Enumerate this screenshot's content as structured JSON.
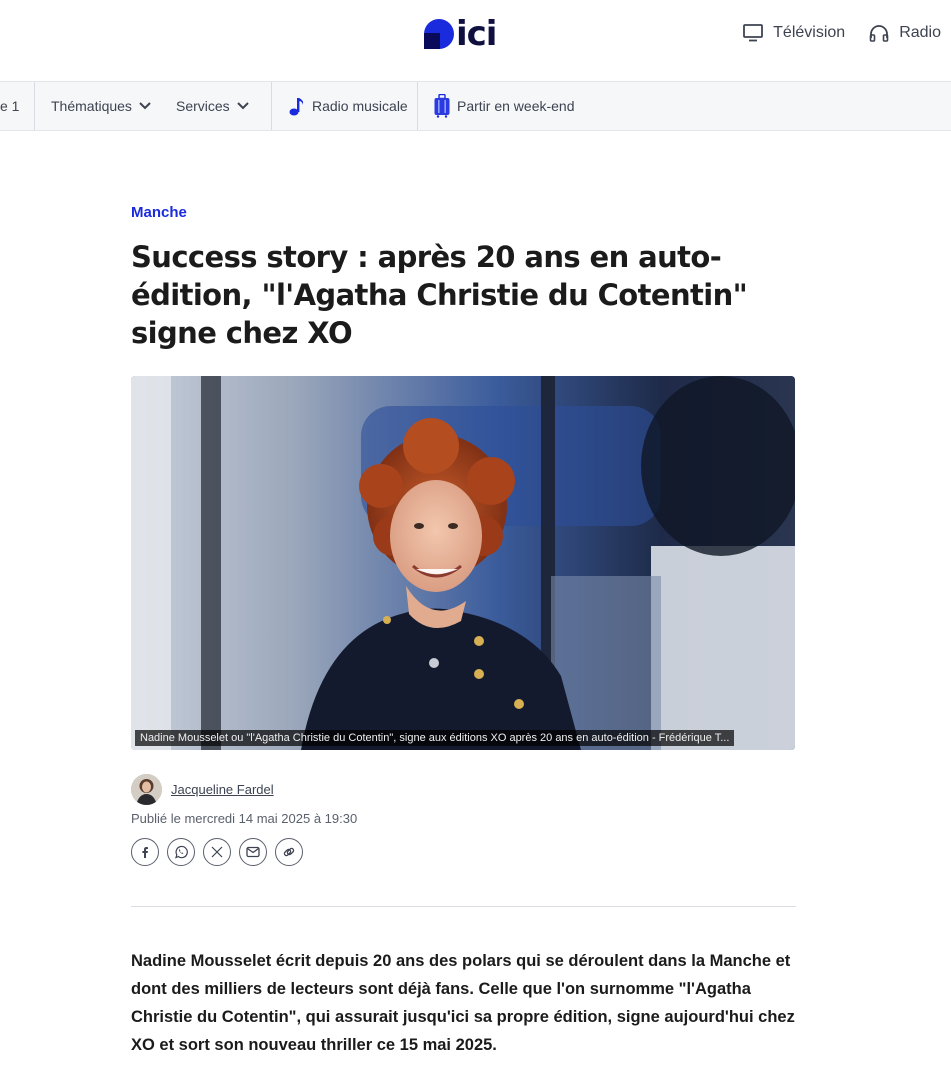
{
  "header": {
    "logo_text": "ici",
    "links": [
      {
        "label": "Télévision",
        "icon": "tv-icon"
      },
      {
        "label": "Radio",
        "icon": "headphones-icon"
      }
    ]
  },
  "nav": {
    "items": [
      {
        "label": "e 1"
      },
      {
        "label": "Thématiques",
        "icon": "chevron-down-icon"
      },
      {
        "label": "Services",
        "icon": "chevron-down-icon"
      },
      {
        "label": "Radio musicale",
        "icon": "music-note-icon"
      },
      {
        "label": "Partir en week-end",
        "icon": "suitcase-icon"
      }
    ]
  },
  "article": {
    "kicker": "Manche",
    "title": "Success story : après 20 ans en auto-édition, \"l'Agatha Christie du Cotentin\" signe chez XO",
    "image_caption": "Nadine Mousselet ou \"l'Agatha Christie du Cotentin\", signe aux éditions XO après 20 ans en auto-édition - Frédérique T...",
    "author": "Jacqueline Fardel",
    "published": "Publié le mercredi 14 mai 2025 à 19:30",
    "share_icons": [
      "facebook-icon",
      "whatsapp-icon",
      "x-icon",
      "email-icon",
      "link-icon"
    ],
    "lead": "Nadine Mousselet écrit depuis 20 ans des polars qui se déroulent dans la Manche et dont des milliers de lecteurs sont déjà fans. Celle que l'on surnomme \"l'Agatha Christie du Cotentin\", qui assurait jusqu'ici sa propre édition, signe aujourd'hui chez XO et sort son nouveau thriller ce 15 mai 2025."
  },
  "colors": {
    "brand_blue": "#1a2bdd",
    "text": "#1b1b1b",
    "nav_bg": "#f6f7f9"
  }
}
